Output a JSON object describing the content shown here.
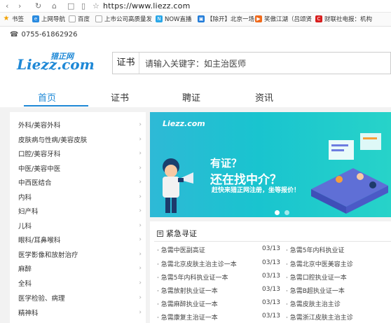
{
  "browser": {
    "url": "https://www.liezz.com",
    "bookmarks": [
      {
        "label": "书签",
        "icon": "star-icon"
      },
      {
        "label": "上网导航",
        "icon": "nav-icon"
      },
      {
        "label": "百度",
        "icon": "page-icon"
      },
      {
        "label": "上市公司高质量发",
        "icon": "page-icon"
      },
      {
        "label": "NOW直播",
        "icon": "now-icon"
      },
      {
        "label": "【除开】北京一场",
        "icon": "tv-icon"
      },
      {
        "label": "笑傲江湖（吕颂贤",
        "icon": "video-icon"
      },
      {
        "label": "财联社电报：机构",
        "icon": "cls-icon"
      }
    ]
  },
  "topbar": {
    "phone": "0755-61862926"
  },
  "header": {
    "logo_cn": "猎正网",
    "logo_en": "Liezz.com",
    "search_type": "证书",
    "search_placeholder": "请输入关键字：如主治医师"
  },
  "nav": {
    "items": [
      "首页",
      "证书",
      "聘证",
      "资讯"
    ],
    "active": "首页"
  },
  "sidebar": {
    "categories": [
      "外科/美容外科",
      "皮肤病与性病/美容皮肤",
      "口腔/美容牙科",
      "中医/美容中医",
      "中西医结合",
      "内科",
      "妇产科",
      "儿科",
      "眼科/耳鼻喉科",
      "医学影像和放射治疗",
      "麻醉",
      "全科",
      "医学检验、病理",
      "精神科"
    ]
  },
  "banner": {
    "logo": "Liezz.com",
    "line1": "有证？",
    "line2": "还在找中介？",
    "sub": "赶快来猎正网注册，坐等报价！",
    "colors": {
      "accent": "#1e88d6",
      "banner_start": "#2eb9d6",
      "banner_end": "#27d3c9"
    }
  },
  "urgent": {
    "title": "紧急寻证",
    "left": [
      {
        "text": "· 急需中医副高证",
        "date": "03/13"
      },
      {
        "text": "· 急需北京皮肤主治主诊一本",
        "date": "03/13"
      },
      {
        "text": "· 急需5年内科执业证一本",
        "date": "03/13"
      },
      {
        "text": "· 急需放射执业证一本",
        "date": "03/13"
      },
      {
        "text": "· 急需麻醉执业证一本",
        "date": "03/13"
      },
      {
        "text": "· 急需康复主治证一本",
        "date": "03/13"
      }
    ],
    "right": [
      {
        "text": "· 急需5年内科执业证"
      },
      {
        "text": "· 急需北京中医美容主诊"
      },
      {
        "text": "· 急需口腔执业证一本"
      },
      {
        "text": "· 急需B超执业证一本"
      },
      {
        "text": "· 急需皮肤主治主诊"
      },
      {
        "text": "· 急需浙江皮肤主治主诊"
      }
    ]
  }
}
